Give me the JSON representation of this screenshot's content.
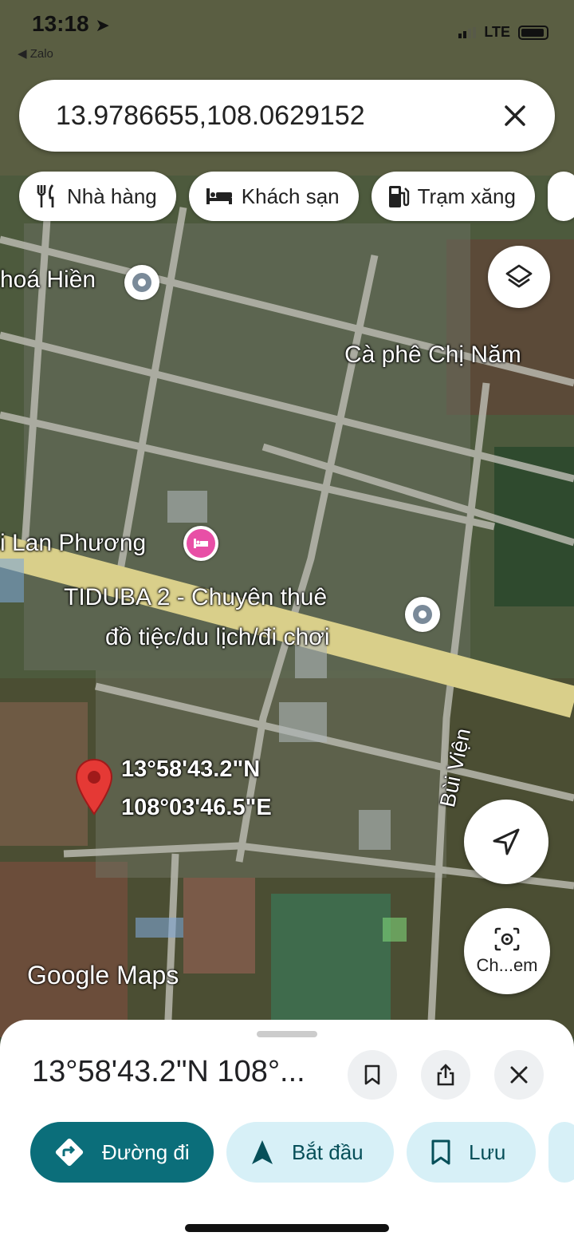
{
  "status_bar": {
    "time": "13:18",
    "back_app": "◀ Zalo",
    "network": "LTE"
  },
  "search": {
    "value": "13.9786655,108.0629152"
  },
  "chips": [
    {
      "label": "Nhà hàng",
      "icon": "restaurant-icon"
    },
    {
      "label": "Khách sạn",
      "icon": "hotel-icon"
    },
    {
      "label": "Trạm xăng",
      "icon": "gas-station-icon"
    }
  ],
  "map": {
    "labels": {
      "hoa_hien": "hoá Hiền",
      "ca_phe": "Cà phê Chị Năm",
      "lan_phuong": "i Lan Phương",
      "tiduba_line1": "TIDUBA 2 - Chuyên thuê",
      "tiduba_line2": "đồ tiệc/du lịch/đi chơi",
      "bui_vien": "Bùi Viện"
    },
    "pin_coords": {
      "lat": "13°58'43.2\"N",
      "lng": "108°03'46.5\"E"
    },
    "logo": "Google Maps",
    "camera_label": "Ch...em"
  },
  "sheet": {
    "title": "13°58'43.2\"N 108°...",
    "actions": [
      {
        "label": "Đường đi",
        "icon": "directions-icon"
      },
      {
        "label": "Bắt đầu",
        "icon": "navigation-arrow-icon"
      },
      {
        "label": "Lưu",
        "icon": "bookmark-icon"
      }
    ]
  },
  "colors": {
    "primary": "#0b6e7a",
    "secondary": "#d7f0f7",
    "pin": "#e53935",
    "hotel_poi": "#e84fa6"
  }
}
